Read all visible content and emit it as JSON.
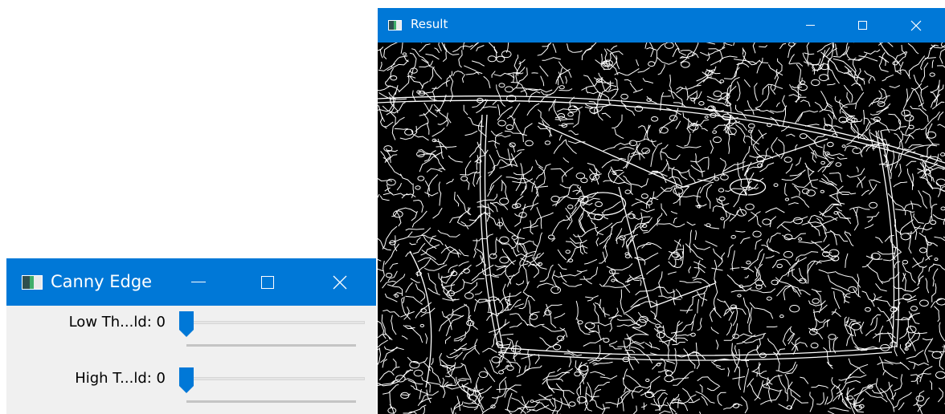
{
  "result_window": {
    "title": "Result",
    "icon": "opencv-window-icon",
    "controls": {
      "minimize": "minimize-icon",
      "maximize": "maximize-icon",
      "close": "close-icon"
    },
    "content": "canny-edge-output-image"
  },
  "canny_window": {
    "title": "Canny Edge",
    "icon": "opencv-window-icon",
    "controls": {
      "minimize": "minimize-icon",
      "maximize": "maximize-icon",
      "close": "close-icon"
    },
    "trackbars": [
      {
        "label": "Low Th...ld: 0",
        "value": 0,
        "fraction": 0
      },
      {
        "label": "High T...ld: 0",
        "value": 0,
        "fraction": 0
      }
    ]
  },
  "colors": {
    "titlebar": "#0078d7",
    "thumb": "#0078d7",
    "panel": "#f0f0f0",
    "canvas": "#000000",
    "edges": "#ffffff"
  }
}
